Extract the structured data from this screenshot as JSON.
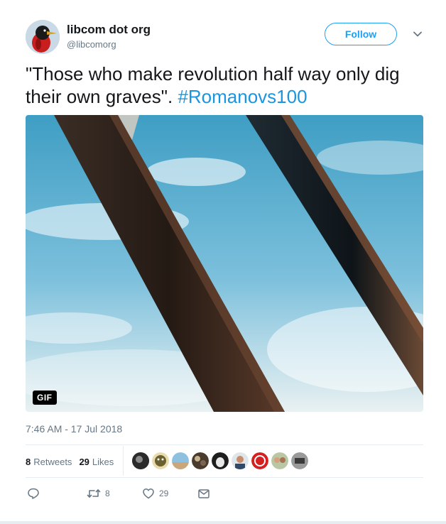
{
  "author": {
    "name": "libcom dot org",
    "handle": "@libcomorg"
  },
  "follow_label": "Follow",
  "tweet": {
    "text": "\"Those who make revolution half way only dig their own graves\". ",
    "hashtag": "#Romanovs100"
  },
  "media": {
    "badge": "GIF"
  },
  "timestamp": "7:46 AM - 17 Jul 2018",
  "stats": {
    "retweets_count": "8",
    "retweets_label": "Retweets",
    "likes_count": "29",
    "likes_label": "Likes"
  },
  "actions": {
    "retweet_count": "8",
    "like_count": "29"
  },
  "colors": {
    "accent": "#1da1f2",
    "link": "#1b95e0",
    "muted": "#657786"
  },
  "icons": [
    "chevron-down-icon",
    "reply-icon",
    "retweet-icon",
    "heart-icon",
    "message-icon"
  ]
}
